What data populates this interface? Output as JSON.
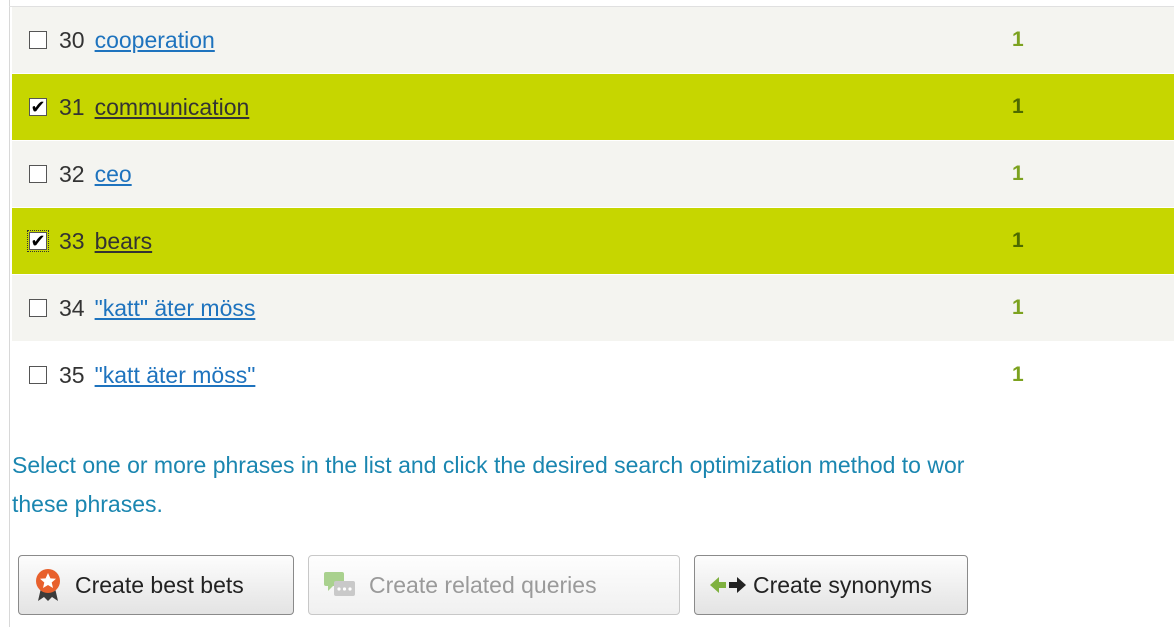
{
  "rows": [
    {
      "num": "30",
      "term": "cooperation",
      "count": "1",
      "checked": false
    },
    {
      "num": "31",
      "term": "communication",
      "count": "1",
      "checked": true
    },
    {
      "num": "32",
      "term": "ceo",
      "count": "1",
      "checked": false
    },
    {
      "num": "33",
      "term": "bears",
      "count": "1",
      "checked": true
    },
    {
      "num": "34",
      "term": "\"katt\" äter möss",
      "count": "1",
      "checked": false
    },
    {
      "num": "35",
      "term": "\"katt äter möss\"",
      "count": "1",
      "checked": false
    }
  ],
  "help": {
    "line1": "Select one or more phrases in the list and click the desired search optimization method to wor",
    "line2": "these phrases."
  },
  "buttons": {
    "best_bets": "Create best bets",
    "related_queries": "Create related queries",
    "synonyms": "Create synonyms"
  },
  "icons": {
    "best_bets": "award-badge-icon",
    "related_queries": "chat-bubbles-icon",
    "synonyms": "two-way-arrows-icon"
  },
  "colors": {
    "selected_row": "#c6d600",
    "link": "#1e73be",
    "count": "#7ca21f",
    "help_text": "#1a86b0"
  }
}
